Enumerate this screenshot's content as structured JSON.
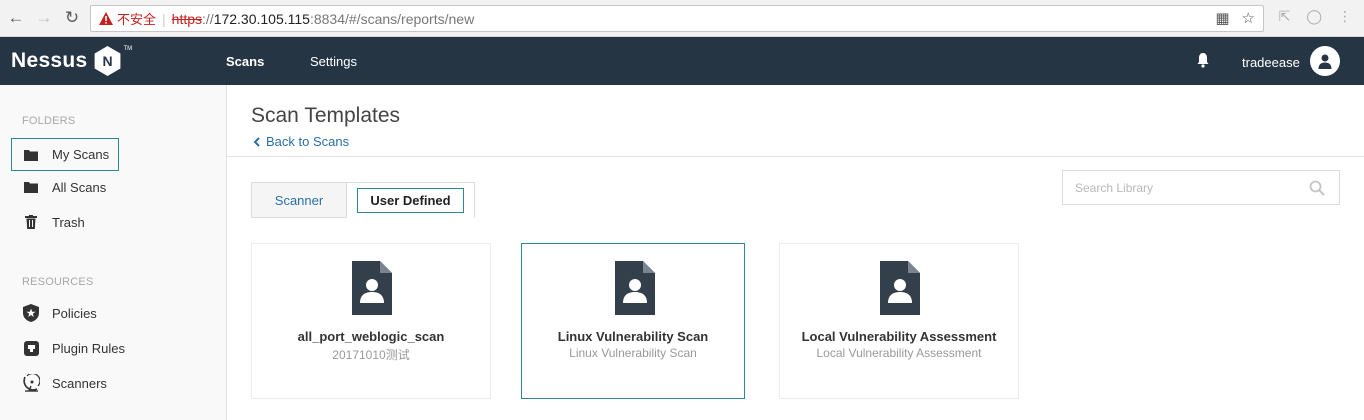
{
  "browser": {
    "insecure_label": "不安全",
    "url_scheme": "https",
    "url_rest_sep": "://",
    "url_host": "172.30.105.115",
    "url_path": ":8834/#/scans/reports/new"
  },
  "app": {
    "brand": "Nessus",
    "brand_badge": "N",
    "brand_tm": "TM",
    "nav": {
      "scans": "Scans",
      "settings": "Settings"
    },
    "username": "tradeease"
  },
  "sidebar": {
    "folders_heading": "FOLDERS",
    "folders": [
      {
        "label": "My Scans",
        "icon": "folder-icon"
      },
      {
        "label": "All Scans",
        "icon": "folder-icon"
      },
      {
        "label": "Trash",
        "icon": "trash-icon"
      }
    ],
    "resources_heading": "RESOURCES",
    "resources": [
      {
        "label": "Policies",
        "icon": "shield-star-icon"
      },
      {
        "label": "Plugin Rules",
        "icon": "plugin-icon"
      },
      {
        "label": "Scanners",
        "icon": "satellite-dish-icon"
      }
    ]
  },
  "main": {
    "title": "Scan Templates",
    "back_link": "Back to Scans",
    "tabs": [
      {
        "label": "Scanner"
      },
      {
        "label": "User Defined"
      }
    ],
    "search": {
      "placeholder": "Search Library"
    },
    "templates": [
      {
        "title": "all_port_weblogic_scan",
        "subtitle": "20171010测试"
      },
      {
        "title": "Linux Vulnerability Scan",
        "subtitle": "Linux Vulnerability Scan"
      },
      {
        "title": "Local Vulnerability Assessment",
        "subtitle": "Local Vulnerability Assessment"
      }
    ]
  },
  "colors": {
    "header_bg": "#263544",
    "accent_outline": "#2a8a8e",
    "link": "#2a6fa8",
    "insecure_red": "#c5221f"
  }
}
